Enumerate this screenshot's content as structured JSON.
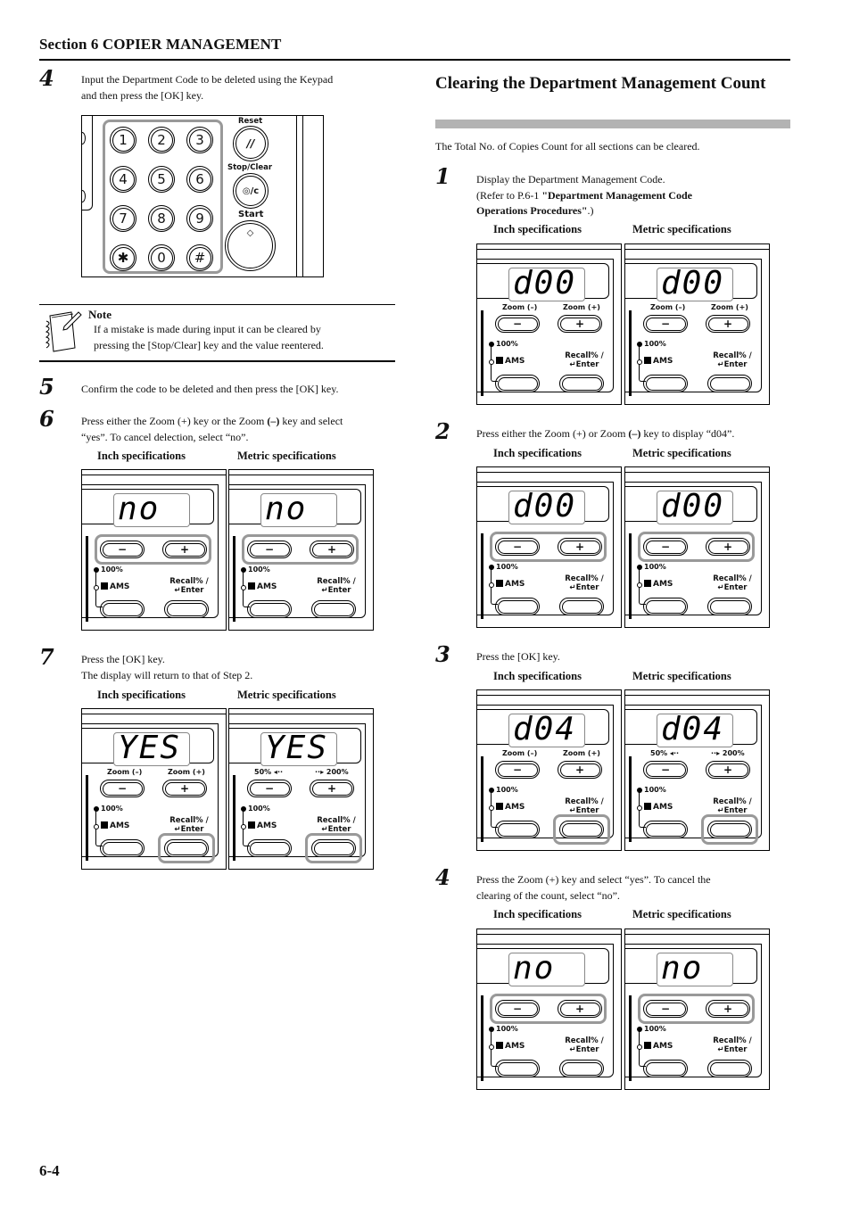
{
  "header": {
    "section_title": "Section 6  COPIER MANAGEMENT",
    "page_number": "6-4"
  },
  "left": {
    "step4": {
      "num": "4",
      "text_line1": "Input the Department Code to be deleted using the Keypad",
      "text_line2": "and then press the [OK] key."
    },
    "keypad": {
      "keys": [
        "1",
        "2",
        "3",
        "4",
        "5",
        "6",
        "7",
        "8",
        "9",
        "✱",
        "0",
        "#"
      ],
      "reset_label": "Reset",
      "stop_clear_label": "Stop/Clear",
      "start_label": "Start",
      "reset_glyph": "//",
      "stop_glyph": "◎/c",
      "start_glyph": "◇"
    },
    "note": {
      "title": "Note",
      "line1": "If a mistake is made during input it can be cleared by",
      "line2": "pressing the [Stop/Clear] key and the value reentered.",
      "icon": "notepad-pencil-icon"
    },
    "step5": {
      "num": "5",
      "text": "Confirm the code to be deleted and then press the [OK] key."
    },
    "step6": {
      "num": "6",
      "text_line1_a": "Press either the Zoom (+) key or the Zoom ",
      "text_line1_b": "(–)",
      "text_line1_c": " key and select",
      "text_line2": "“yes”. To cancel delection, select “no”.",
      "inch_label": "Inch specifications",
      "metric_label": "Metric specifications",
      "display": "no"
    },
    "step7": {
      "num": "7",
      "text_line1": "Press the [OK] key.",
      "text_line2": "The display will return to that of Step 2.",
      "inch_label": "Inch specifications",
      "metric_label": "Metric specifications",
      "display": "YES"
    }
  },
  "right": {
    "heading": "Clearing the Department Management Count",
    "intro": "The Total No. of Copies Count for all sections can be cleared.",
    "step1": {
      "num": "1",
      "text_line1": "Display the Department Management Code.",
      "text_line2_a": "(Refer to P.6-1 ",
      "text_line2_b": "\"Department Management Code",
      "text_line3_b": "Operations Procedures\"",
      "text_line3_c": ".)",
      "inch_label": "Inch specifications",
      "metric_label": "Metric specifications",
      "display": "d00"
    },
    "step2": {
      "num": "2",
      "text_a": "Press either the Zoom (+) or Zoom ",
      "text_b": "(–)",
      "text_c": " key to display “d04”.",
      "inch_label": "Inch specifications",
      "metric_label": "Metric specifications",
      "display": "d00"
    },
    "step3": {
      "num": "3",
      "text": "Press the [OK] key.",
      "inch_label": "Inch specifications",
      "metric_label": "Metric specifications",
      "display": "d04"
    },
    "step4": {
      "num": "4",
      "text_line1": "Press the Zoom (+) key and select “yes”. To cancel the",
      "text_line2": "clearing of the count, select “no”.",
      "inch_label": "Inch specifications",
      "metric_label": "Metric specifications",
      "display": "no"
    }
  },
  "panel_labels": {
    "inch_zoom_minus": "Zoom (–)",
    "inch_zoom_plus": "Zoom (+)",
    "metric_zoom_minus": "50% ◂··",
    "metric_zoom_plus": "··▸ 200%",
    "minus_glyph": "−",
    "plus_glyph": "+",
    "pct100": "100%",
    "ams": "AMS",
    "recall_line1": "Recall% /",
    "recall_line2": "↵Enter"
  }
}
